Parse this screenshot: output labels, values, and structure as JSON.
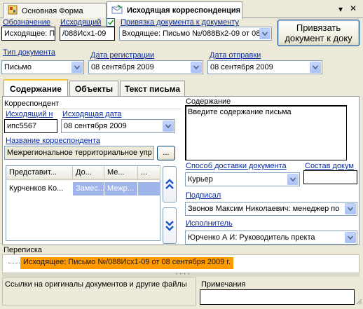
{
  "tabs": [
    {
      "label": "Основная Форма",
      "active": false
    },
    {
      "label": "Исходящая корреспонденция",
      "active": true
    }
  ],
  "window_controls": {
    "menu": "▾",
    "close": "✕"
  },
  "header": {
    "oboznachenie": {
      "label": "Обозначение",
      "value": "Исходящее: П"
    },
    "iskhodyashchiy": {
      "label": "Исходящий",
      "value": "/088Исх1-09",
      "checked": true
    },
    "privyazka": {
      "label": "Привязка документа к документу",
      "value": "Входящее: Письмо №/088Вх2-09 от 08"
    },
    "bind_button": "Привязать документ к доку"
  },
  "row2": {
    "doc_type": {
      "label": "Тип документа",
      "value": "Письмо"
    },
    "reg_date": {
      "label": "Дата регистрации",
      "value": "08 сентября 2009"
    },
    "send_date": {
      "label": "Дата отправки",
      "value": "08 сентября 2009"
    }
  },
  "inner_tabs": [
    {
      "label": "Содержание",
      "active": true
    },
    {
      "label": "Объекты",
      "active": false
    },
    {
      "label": "Текст письма",
      "active": false
    }
  ],
  "correspondent": {
    "group_label": "Корреспондент",
    "out_number": {
      "label": "Исходящий н",
      "value": "ипс5567"
    },
    "out_date": {
      "label": "Исходящая дата",
      "value": "08 сентября 2009"
    },
    "name": {
      "label": "Название корреспондента",
      "value": "Межрегиональное территориальное упр"
    },
    "ellipsis_button": "...",
    "grid": {
      "columns": [
        "Представит...",
        "До...",
        "Ме...",
        "..."
      ],
      "rows": [
        [
          "Курченков Ко...",
          "Замес...",
          "Межр...",
          ""
        ]
      ]
    }
  },
  "content": {
    "label": "Содержание",
    "placeholder": "Введите содержание письма"
  },
  "delivery": {
    "label": "Способ доставки документа",
    "value": "Курьер",
    "composition_label": "Состав докум",
    "composition_value": ""
  },
  "signed": {
    "label": "Подписал",
    "value": "Звонов Максим Николаевич:  менеджер по"
  },
  "executor": {
    "label": "Исполнитель",
    "value": "Юрченко А И:  Руководитель пректа"
  },
  "correspondence": {
    "label": "Переписка",
    "item": "Исходящее: Письмо №/088Исх1-09 от 08 сентября 2009 г."
  },
  "links": {
    "label": "Ссылки на оригиналы документов и другие файлы"
  },
  "notes": {
    "label": "Примечания"
  },
  "colors": {
    "accent_orange": "#ff9900",
    "selection_blue": "#316ac5",
    "label_blue": "#0a2c9c"
  }
}
